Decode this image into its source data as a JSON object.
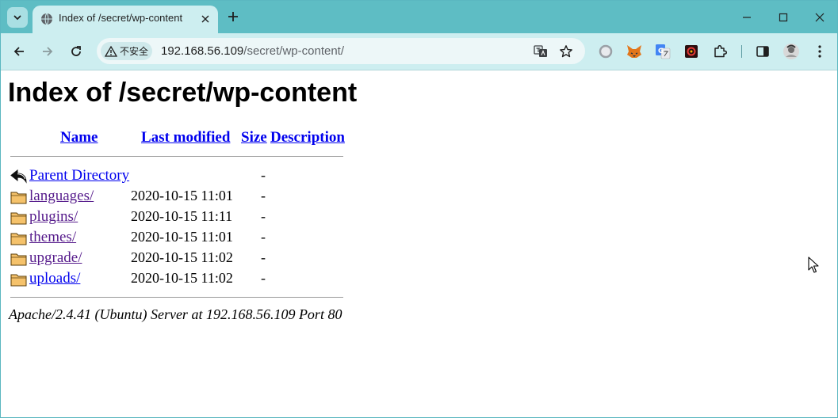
{
  "browser": {
    "tab": {
      "title": "Index of /secret/wp-content"
    },
    "omnibox": {
      "security_label": "不安全",
      "url_host": "192.168.56.109",
      "url_path": "/secret/wp-content/"
    }
  },
  "page": {
    "heading": "Index of /secret/wp-content",
    "columns": {
      "name": "Name",
      "last_modified": "Last modified",
      "size": "Size",
      "description": "Description"
    },
    "parent": {
      "name": "Parent Directory",
      "size": "-"
    },
    "entries": [
      {
        "name": "languages/",
        "modified": "2020-10-15 11:01",
        "size": "-"
      },
      {
        "name": "plugins/",
        "modified": "2020-10-15 11:11",
        "size": "-"
      },
      {
        "name": "themes/",
        "modified": "2020-10-15 11:01",
        "size": "-"
      },
      {
        "name": "upgrade/",
        "modified": "2020-10-15 11:02",
        "size": "-"
      },
      {
        "name": "uploads/",
        "modified": "2020-10-15 11:02",
        "size": "-"
      }
    ],
    "address": "Apache/2.4.41 (Ubuntu) Server at 192.168.56.109 Port 80"
  },
  "colors": {
    "tabstrip": "#5ebdc4",
    "toolbar": "#cdeef0",
    "link": "#0000ee",
    "visited_link": "#551a8b"
  },
  "icons": {
    "tab_search": "chevron-down-icon",
    "favicon": "globe-icon",
    "tab_close": "close-icon",
    "new_tab": "plus-icon",
    "minimize": "minimize-icon",
    "maximize": "maximize-icon",
    "close_window": "close-icon",
    "back": "arrow-left-icon",
    "forward": "arrow-right-icon",
    "reload": "reload-icon",
    "warning": "warning-icon",
    "translate": "translate-icon",
    "bookmark": "star-icon",
    "extensions": [
      "circle-extension-icon",
      "fox-extension-icon",
      "google-translate-icon",
      "red-extension-icon",
      "puzzle-icon"
    ],
    "side_panel": "side-panel-icon",
    "profile": "avatar",
    "menu": "kebab-menu-icon",
    "parent_dir": "back-arrow-icon",
    "folder": "folder-icon"
  }
}
